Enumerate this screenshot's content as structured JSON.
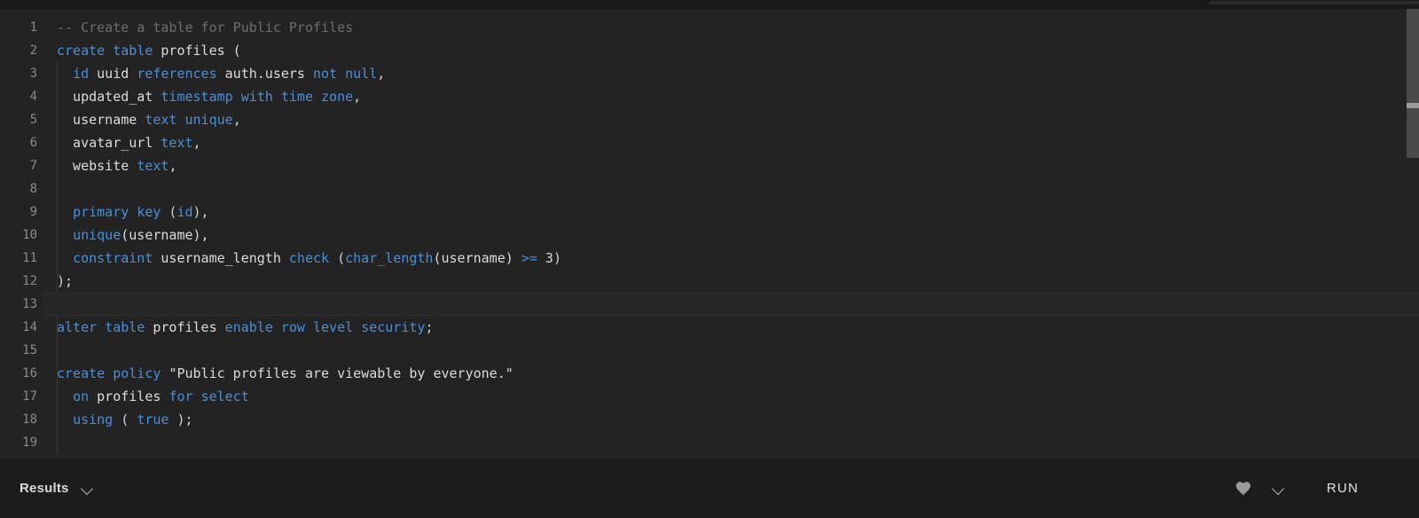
{
  "window": {
    "background": "#1c1c1c",
    "editor_background": "#232323",
    "accent_keyword_color": "#4a90d9",
    "text_color": "#d4d4d4",
    "comment_color": "#6e6e6e",
    "gutter_color": "#8b8b8b"
  },
  "editor": {
    "language": "sql",
    "active_line": 13,
    "first_visible_line": 1,
    "last_visible_line": 19,
    "lines": [
      {
        "number": "1",
        "tokens": [
          {
            "t": "-- Create a table for Public Profiles",
            "c": "cmt"
          }
        ]
      },
      {
        "number": "2",
        "tokens": [
          {
            "t": "create",
            "c": "kw"
          },
          {
            "t": " ",
            "c": "pun"
          },
          {
            "t": "table",
            "c": "kw"
          },
          {
            "t": " profiles (",
            "c": "id"
          }
        ]
      },
      {
        "number": "3",
        "tokens": [
          {
            "t": "  ",
            "c": "pun"
          },
          {
            "t": "id",
            "c": "kw"
          },
          {
            "t": " uuid ",
            "c": "id"
          },
          {
            "t": "references",
            "c": "kw"
          },
          {
            "t": " auth.users ",
            "c": "id"
          },
          {
            "t": "not",
            "c": "kw"
          },
          {
            "t": " ",
            "c": "pun"
          },
          {
            "t": "null",
            "c": "kw"
          },
          {
            "t": ",",
            "c": "pun"
          }
        ]
      },
      {
        "number": "4",
        "tokens": [
          {
            "t": "  updated_at ",
            "c": "id"
          },
          {
            "t": "timestamp",
            "c": "kw"
          },
          {
            "t": " ",
            "c": "pun"
          },
          {
            "t": "with",
            "c": "kw"
          },
          {
            "t": " ",
            "c": "pun"
          },
          {
            "t": "time",
            "c": "kw"
          },
          {
            "t": " ",
            "c": "pun"
          },
          {
            "t": "zone",
            "c": "kw"
          },
          {
            "t": ",",
            "c": "pun"
          }
        ]
      },
      {
        "number": "5",
        "tokens": [
          {
            "t": "  username ",
            "c": "id"
          },
          {
            "t": "text",
            "c": "kw"
          },
          {
            "t": " ",
            "c": "pun"
          },
          {
            "t": "unique",
            "c": "kw"
          },
          {
            "t": ",",
            "c": "pun"
          }
        ]
      },
      {
        "number": "6",
        "tokens": [
          {
            "t": "  avatar_url ",
            "c": "id"
          },
          {
            "t": "text",
            "c": "kw"
          },
          {
            "t": ",",
            "c": "pun"
          }
        ]
      },
      {
        "number": "7",
        "tokens": [
          {
            "t": "  website ",
            "c": "id"
          },
          {
            "t": "text",
            "c": "kw"
          },
          {
            "t": ",",
            "c": "pun"
          }
        ]
      },
      {
        "number": "8",
        "tokens": [
          {
            "t": "",
            "c": "id"
          }
        ]
      },
      {
        "number": "9",
        "tokens": [
          {
            "t": "  ",
            "c": "pun"
          },
          {
            "t": "primary",
            "c": "kw"
          },
          {
            "t": " ",
            "c": "pun"
          },
          {
            "t": "key",
            "c": "kw"
          },
          {
            "t": " (",
            "c": "pun"
          },
          {
            "t": "id",
            "c": "kw"
          },
          {
            "t": "),",
            "c": "pun"
          }
        ]
      },
      {
        "number": "10",
        "tokens": [
          {
            "t": "  ",
            "c": "pun"
          },
          {
            "t": "unique",
            "c": "kw"
          },
          {
            "t": "(username),",
            "c": "id"
          }
        ]
      },
      {
        "number": "11",
        "tokens": [
          {
            "t": "  ",
            "c": "pun"
          },
          {
            "t": "constraint",
            "c": "kw"
          },
          {
            "t": " username_length ",
            "c": "id"
          },
          {
            "t": "check",
            "c": "kw"
          },
          {
            "t": " (",
            "c": "pun"
          },
          {
            "t": "char_length",
            "c": "kw"
          },
          {
            "t": "(username) ",
            "c": "id"
          },
          {
            "t": ">=",
            "c": "kw"
          },
          {
            "t": " ",
            "c": "pun"
          },
          {
            "t": "3",
            "c": "num"
          },
          {
            "t": ")",
            "c": "pun"
          }
        ]
      },
      {
        "number": "12",
        "tokens": [
          {
            "t": ");",
            "c": "pun"
          }
        ]
      },
      {
        "number": "13",
        "tokens": [
          {
            "t": "",
            "c": "id"
          }
        ]
      },
      {
        "number": "14",
        "tokens": [
          {
            "t": "alter",
            "c": "kw"
          },
          {
            "t": " ",
            "c": "pun"
          },
          {
            "t": "table",
            "c": "kw"
          },
          {
            "t": " profiles ",
            "c": "id"
          },
          {
            "t": "enable",
            "c": "kw"
          },
          {
            "t": " ",
            "c": "pun"
          },
          {
            "t": "row",
            "c": "kw"
          },
          {
            "t": " ",
            "c": "pun"
          },
          {
            "t": "level",
            "c": "kw"
          },
          {
            "t": " ",
            "c": "pun"
          },
          {
            "t": "security",
            "c": "kw"
          },
          {
            "t": ";",
            "c": "pun"
          }
        ]
      },
      {
        "number": "15",
        "tokens": [
          {
            "t": "",
            "c": "id"
          }
        ]
      },
      {
        "number": "16",
        "tokens": [
          {
            "t": "create",
            "c": "kw"
          },
          {
            "t": " ",
            "c": "pun"
          },
          {
            "t": "policy",
            "c": "kw"
          },
          {
            "t": " ",
            "c": "pun"
          },
          {
            "t": "\"Public profiles are viewable by everyone.\"",
            "c": "str"
          }
        ]
      },
      {
        "number": "17",
        "tokens": [
          {
            "t": "  ",
            "c": "pun"
          },
          {
            "t": "on",
            "c": "kw"
          },
          {
            "t": " profiles ",
            "c": "id"
          },
          {
            "t": "for",
            "c": "kw"
          },
          {
            "t": " ",
            "c": "pun"
          },
          {
            "t": "select",
            "c": "kw"
          }
        ]
      },
      {
        "number": "18",
        "tokens": [
          {
            "t": "  ",
            "c": "pun"
          },
          {
            "t": "using",
            "c": "kw"
          },
          {
            "t": " ( ",
            "c": "pun"
          },
          {
            "t": "true",
            "c": "kw"
          },
          {
            "t": " );",
            "c": "pun"
          }
        ]
      },
      {
        "number": "19",
        "tokens": [
          {
            "t": "",
            "c": "id"
          }
        ]
      }
    ],
    "full_text": "-- Create a table for Public Profiles\ncreate table profiles (\n  id uuid references auth.users not null,\n  updated_at timestamp with time zone,\n  username text unique,\n  avatar_url text,\n  website text,\n\n  primary key (id),\n  unique(username),\n  constraint username_length check (char_length(username) >= 3)\n);\n\nalter table profiles enable row level security;\n\ncreate policy \"Public profiles are viewable by everyone.\"\n  on profiles for select\n  using ( true );\n"
  },
  "bottom_bar": {
    "results_label": "Results",
    "results_chevron_icon": "chevron-down-icon",
    "favorite_icon": "heart-icon",
    "options_chevron_icon": "chevron-down-icon",
    "run_label": "RUN"
  }
}
